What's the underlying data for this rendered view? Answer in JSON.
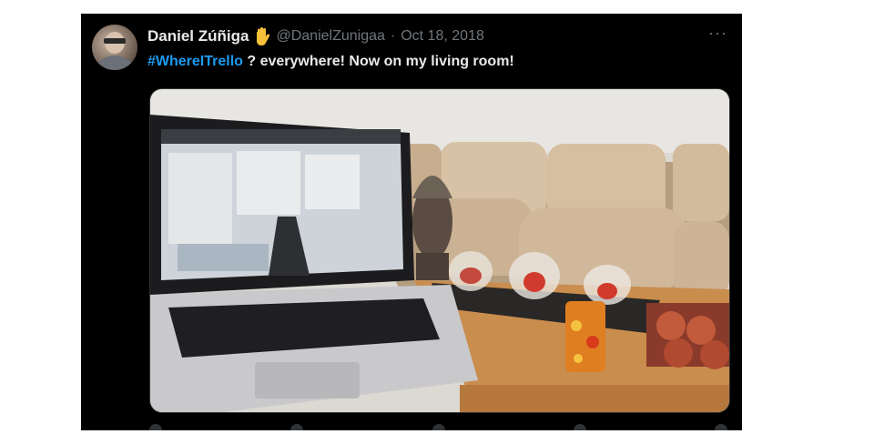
{
  "tweet": {
    "author_name": "Daniel Zúñiga",
    "author_emoji_icon": "raised-hand-emoji",
    "handle": "@DanielZunigaa",
    "separator": "·",
    "date": "Oct 18, 2018",
    "more_label": "···",
    "hashtag": "#WhereITrello",
    "body": " ? everywhere! Now on my living room!",
    "media_alt": "photo-laptop-on-living-room-table"
  },
  "colors": {
    "background": "#000000",
    "text": "#e7e9ea",
    "muted": "#71767b",
    "link": "#1d9bf0"
  }
}
